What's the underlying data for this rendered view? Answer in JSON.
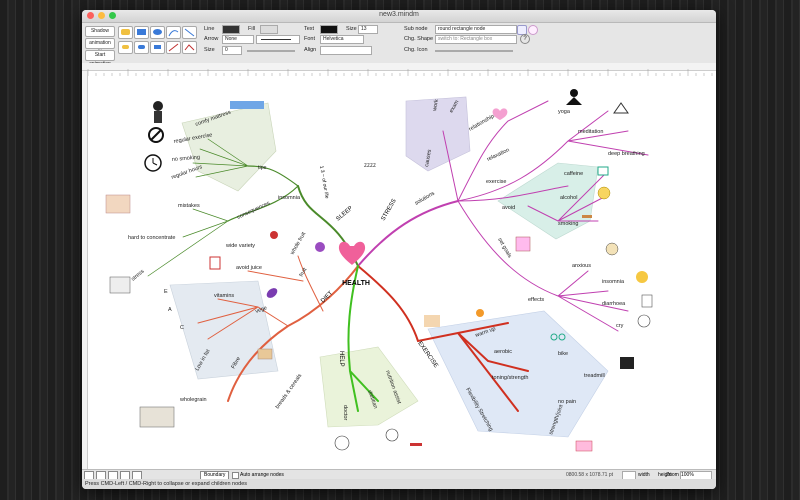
{
  "window": {
    "title": "new3.mindm"
  },
  "toolbar": {
    "shadow_label": "Shadow",
    "animation_setting_label": "animation setting",
    "start_animation_label": "Start animation",
    "line_label": "Line",
    "fill_label": "Fill",
    "arrow_label": "Arrow",
    "arrow_value": "None",
    "size_label": "Size",
    "size_value": "0",
    "text_label": "Text",
    "text_size_label": "Size",
    "text_size_value": "13",
    "font_label": "Font",
    "font_value": "Helvetica",
    "align_label": "Align",
    "subnode_label": "Sub node",
    "subnode_value": "round rectangle node",
    "chg_shape_label": "Chg. Shape",
    "chg_shape_value": "switch to: Rectangle box",
    "chg_icon_label": "Chg. Icon",
    "help_label": "?"
  },
  "map": {
    "center": "HEALTH",
    "branches": {
      "sleep": {
        "label": "SLEEP",
        "note": "1 3 ~ of our life",
        "children": [
          "insomnia",
          "tips",
          "consequences",
          "mistakes",
          "hard to concentrate",
          "stress",
          "comfy mattress",
          "regular exercise",
          "no smoking",
          "regular hours"
        ]
      },
      "stress": {
        "label": "STRESS",
        "children": [
          "causes",
          "work",
          "exam",
          "relationships",
          "solutions",
          "relaxation",
          "yoga",
          "meditation",
          "deep breathing",
          "exercise",
          "avoid",
          "caffeine",
          "alcohol",
          "smoking",
          "set goals",
          "effects",
          "anxious",
          "insomnia",
          "diarrhoea",
          "cry"
        ]
      },
      "diet": {
        "label": "DIET",
        "children": [
          "fruit",
          "whole fruit",
          "wide variety",
          "avoid juice",
          "vege",
          "vitamins",
          "E",
          "A",
          "C",
          "Low in fat",
          "Fibre",
          "breads & cereals",
          "wholegrain"
        ]
      },
      "exercise": {
        "label": "EXERCISE",
        "children": [
          "warm up",
          "aerobic",
          "bike",
          "treadmill",
          "toning/strength",
          "no pain",
          "Flexibility Stretching",
          "strength/joint"
        ]
      },
      "help": {
        "label": "HELP",
        "children": [
          "doctor",
          "dietitian",
          "nutrition assist"
        ]
      }
    }
  },
  "bottom": {
    "boundary_label": "Boundary",
    "auto_arrange_label": "Auto arrange nodes",
    "coords": "0800.58 x 1078.71 pt",
    "width_label": "width",
    "height_label": "height",
    "zoom_label": "Zoom",
    "zoom_value": "100%"
  },
  "status": {
    "text": "Press CMD-Left / CMD-Right to collapse or expand children nodes"
  },
  "colors": {
    "sleep": "#4a8a2a",
    "stress": "#c040b0",
    "diet": "#e06040",
    "exercise": "#d03020",
    "help": "#40c020"
  }
}
